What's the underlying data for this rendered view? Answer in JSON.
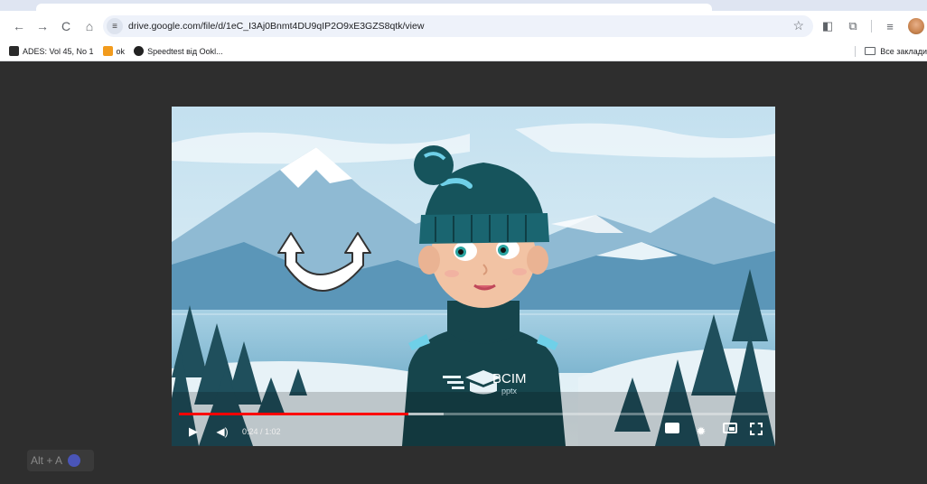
{
  "browser": {
    "url": "drive.google.com/file/d/1eC_I3Aj0Bnmt4DU9qIP2O9xE3GZS8qtk/view",
    "nav": {
      "back_icon": "←",
      "forward_icon": "→",
      "reload_icon": "C",
      "home_icon": "⌂",
      "star_icon": "☆"
    },
    "bookmarks": [
      {
        "label": "ADES: Vol 45, No 1"
      },
      {
        "label": "ok"
      },
      {
        "label": "Speedtest від Ookl..."
      }
    ],
    "all_bookmarks_label": "Все заклади"
  },
  "video": {
    "logo_text": "BCIM",
    "logo_sub": "pptx",
    "time": "0:24 / 1:02",
    "progress": 0.39,
    "buffered": 0.45,
    "play_icon": "▶",
    "volume_icon": "◀)",
    "settings_icon": "✹"
  },
  "shortcut_badge": {
    "label": "Alt + A"
  }
}
